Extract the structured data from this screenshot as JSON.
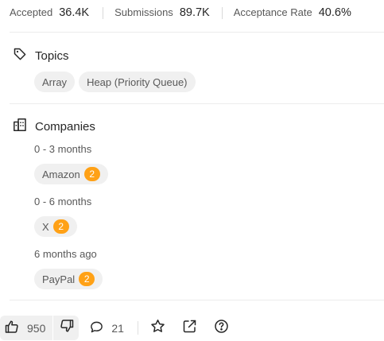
{
  "stats": [
    {
      "label": "Accepted",
      "value": "36.4K"
    },
    {
      "label": "Submissions",
      "value": "89.7K"
    },
    {
      "label": "Acceptance Rate",
      "value": "40.6%"
    }
  ],
  "topics": {
    "title": "Topics",
    "icon": "tag-icon",
    "tags": [
      "Array",
      "Heap (Priority Queue)"
    ]
  },
  "companies": {
    "title": "Companies",
    "icon": "building-icon",
    "groups": [
      {
        "period": "0 - 3 months",
        "companies": [
          {
            "name": "Amazon",
            "count": "2"
          }
        ]
      },
      {
        "period": "0 - 6 months",
        "companies": [
          {
            "name": "X",
            "count": "2"
          }
        ]
      },
      {
        "period": "6 months ago",
        "companies": [
          {
            "name": "PayPal",
            "count": "2"
          }
        ]
      }
    ]
  },
  "footer": {
    "likes": "950",
    "comments": "21",
    "icons": [
      "thumbs-up-icon",
      "thumbs-down-icon",
      "comment-icon",
      "star-icon",
      "share-icon",
      "help-icon"
    ]
  },
  "colors": {
    "badge": "#ffa116",
    "chip_bg": "#f0f0f0",
    "text": "#262626",
    "muted": "#595959"
  }
}
